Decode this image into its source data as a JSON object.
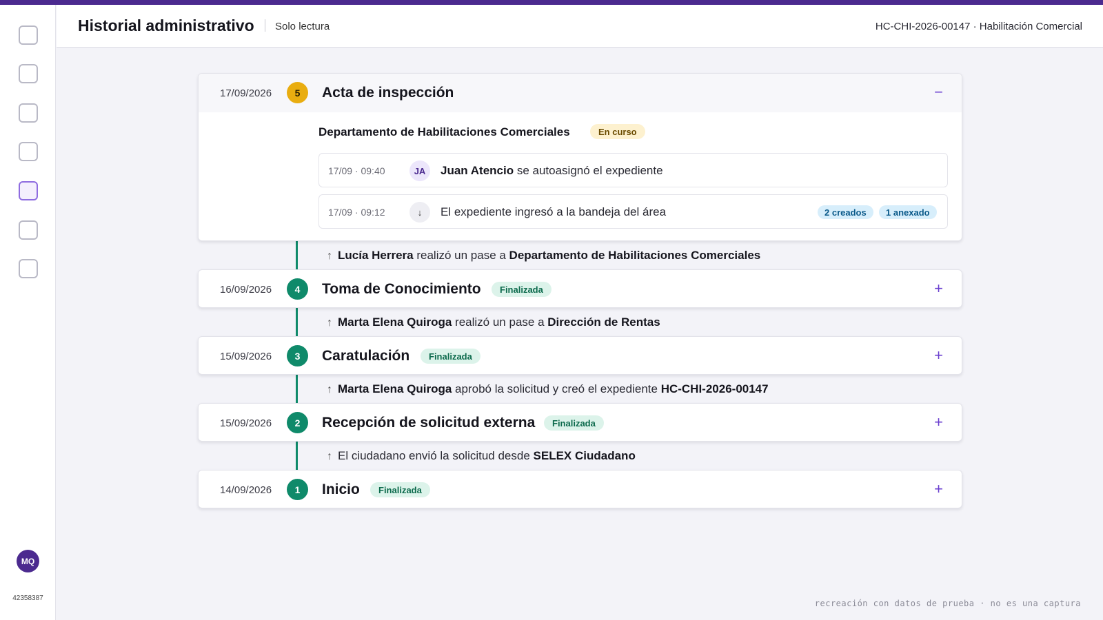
{
  "header": {
    "title": "Historial administrativo",
    "mode": "Solo lectura",
    "file_info": "HC-CHI-2026-00147 · Habilitación Comercial"
  },
  "sidebar": {
    "items": [
      {
        "icon": "nav-icon-1"
      },
      {
        "icon": "nav-icon-2"
      },
      {
        "icon": "nav-icon-3"
      },
      {
        "icon": "nav-icon-4"
      },
      {
        "icon": "nav-icon-5",
        "active": true
      },
      {
        "icon": "nav-icon-6"
      },
      {
        "icon": "nav-icon-7"
      }
    ],
    "user_initials": "MQ",
    "user_id": "42358387"
  },
  "steps": [
    {
      "date": "17/09/2026",
      "number": "5",
      "title": "Acta de inspección",
      "expanded": true,
      "toggle": "−",
      "department": "Departamento de Habilitaciones Comerciales",
      "status": "En curso",
      "events": [
        {
          "time": "17/09 · 09:40",
          "icon": "JA",
          "actor": "Juan Atencio",
          "text": " se autoasignó el expediente"
        },
        {
          "time": "17/09 · 09:12",
          "icon": "↓",
          "text": "El expediente ingresó a la bandeja del área",
          "tags": [
            "2 creados",
            "1 anexado"
          ]
        }
      ]
    },
    {
      "date": "16/09/2026",
      "number": "4",
      "title": "Toma de Conocimiento",
      "status": "Finalizada",
      "toggle": "+"
    },
    {
      "date": "15/09/2026",
      "number": "3",
      "title": "Caratulación",
      "status": "Finalizada",
      "toggle": "+"
    },
    {
      "date": "15/09/2026",
      "number": "2",
      "title": "Recepción de solicitud externa",
      "status": "Finalizada",
      "toggle": "+"
    },
    {
      "date": "14/09/2026",
      "number": "1",
      "title": "Inicio",
      "status": "Finalizada",
      "toggle": "+"
    }
  ],
  "transitions": [
    {
      "arrow": "↑",
      "actor": "Lucía Herrera",
      "text": " realizó un pase a ",
      "target": "Departamento de Habilitaciones Comerciales"
    },
    {
      "arrow": "↑",
      "actor": "Marta Elena Quiroga",
      "text": " realizó un pase a ",
      "target": "Dirección de Rentas"
    },
    {
      "arrow": "↑",
      "actor": "Marta Elena Quiroga",
      "text": " aprobó la solicitud y creó el expediente ",
      "target": "HC-CHI-2026-00147"
    },
    {
      "arrow": "↑",
      "actor": "",
      "text": "El ciudadano envió la solicitud desde ",
      "target": "SELEX Ciudadano"
    }
  ],
  "footer_note": "recreación con datos de prueba · no es una captura",
  "colors": {
    "brand": "#4b2a8f",
    "success": "#0f8a6a",
    "current": "#e9ad10",
    "accent": "#6a3fcf"
  }
}
